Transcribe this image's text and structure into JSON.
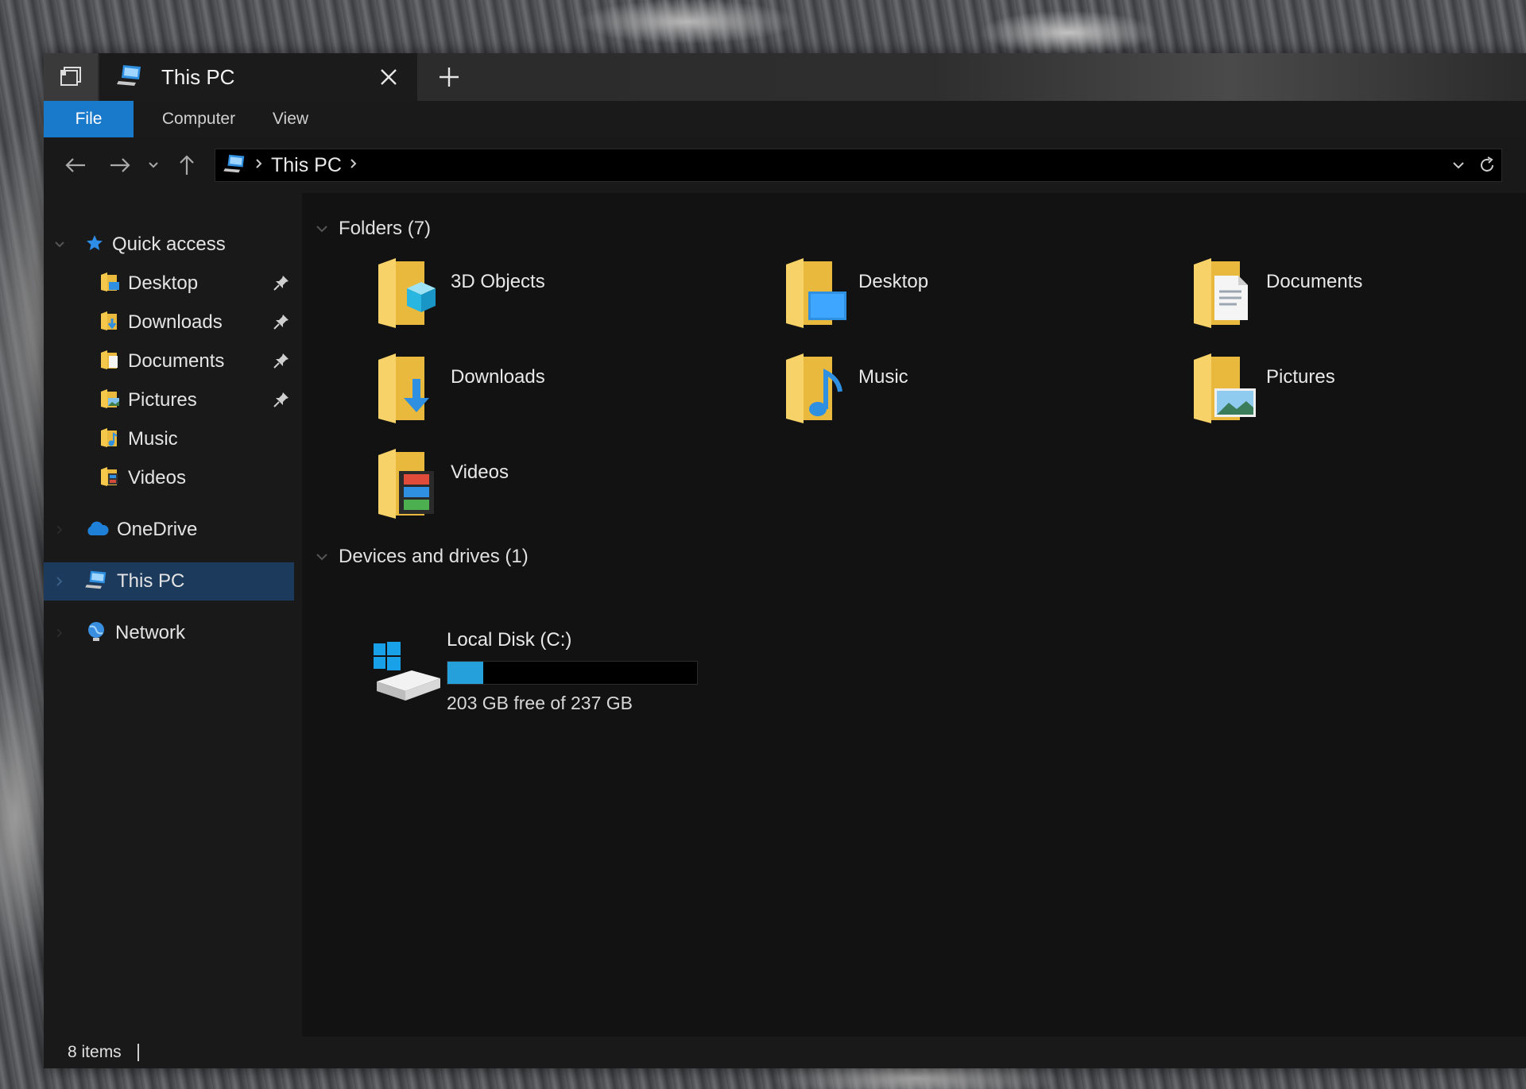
{
  "window": {
    "tab_title": "This PC",
    "close_glyph": "✕",
    "newtab_glyph": "+"
  },
  "ribbon": {
    "tabs": [
      "File",
      "Computer",
      "View"
    ]
  },
  "address": {
    "crumbs": [
      "This PC"
    ]
  },
  "sidebar": {
    "quick_access": "Quick access",
    "quick_items": [
      {
        "label": "Desktop",
        "pinned": true
      },
      {
        "label": "Downloads",
        "pinned": true
      },
      {
        "label": "Documents",
        "pinned": true
      },
      {
        "label": "Pictures",
        "pinned": true
      },
      {
        "label": "Music",
        "pinned": false
      },
      {
        "label": "Videos",
        "pinned": false
      }
    ],
    "onedrive": "OneDrive",
    "thispc": "This PC",
    "network": "Network"
  },
  "content": {
    "folders_header": "Folders (7)",
    "folders": [
      {
        "name": "3D Objects",
        "overlay": "cube"
      },
      {
        "name": "Desktop",
        "overlay": "desktop"
      },
      {
        "name": "Documents",
        "overlay": "document"
      },
      {
        "name": "Downloads",
        "overlay": "download-arrow"
      },
      {
        "name": "Music",
        "overlay": "music-note"
      },
      {
        "name": "Pictures",
        "overlay": "picture"
      },
      {
        "name": "Videos",
        "overlay": "film"
      }
    ],
    "drives_header": "Devices and drives (1)",
    "drive": {
      "name": "Local Disk (C:)",
      "free_text": "203 GB free of 237 GB",
      "used_fraction": 0.1435
    }
  },
  "status": {
    "item_count": "8 items"
  },
  "colors": {
    "accent": "#1979ca",
    "selection": "#1b3a5c",
    "drive_fill": "#26a0da",
    "folder_yellow": "#f5c84c"
  }
}
